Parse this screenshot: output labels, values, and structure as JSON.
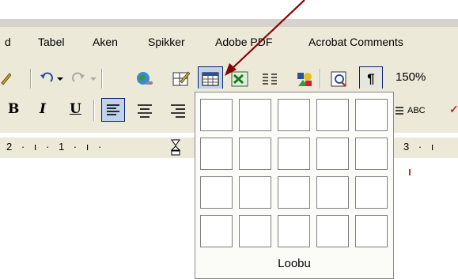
{
  "menu": {
    "items": [
      "d",
      "Tabel",
      "Aken",
      "Spikker",
      "Adobe PDF",
      "Acrobat Comments"
    ]
  },
  "toolbar1": {
    "undo_icon": "undo-icon",
    "redo_icon": "redo-icon",
    "hyperlink_icon": "globe-link-icon",
    "tables_borders_icon": "tables-borders-icon",
    "insert_table_icon": "insert-table-icon",
    "insert_excel_icon": "excel-sheet-icon",
    "columns_icon": "columns-icon",
    "drawing_icon": "drawing-icon",
    "doc_map_icon": "document-map-icon",
    "show_hide_glyph": "¶",
    "zoom_value": "150%"
  },
  "toolbar2": {
    "bold": "B",
    "italic": "I",
    "underline": "U",
    "spelling_label": "ABC"
  },
  "ruler": {
    "left_marks": "2 · ı · 1 · ı ·",
    "right_marks": "3 · ı"
  },
  "table_picker": {
    "rows": 4,
    "cols": 5,
    "cancel_label": "Loobu"
  },
  "colors": {
    "toolbar_bg": "#ece9d8",
    "arrow": "#8b0000"
  }
}
